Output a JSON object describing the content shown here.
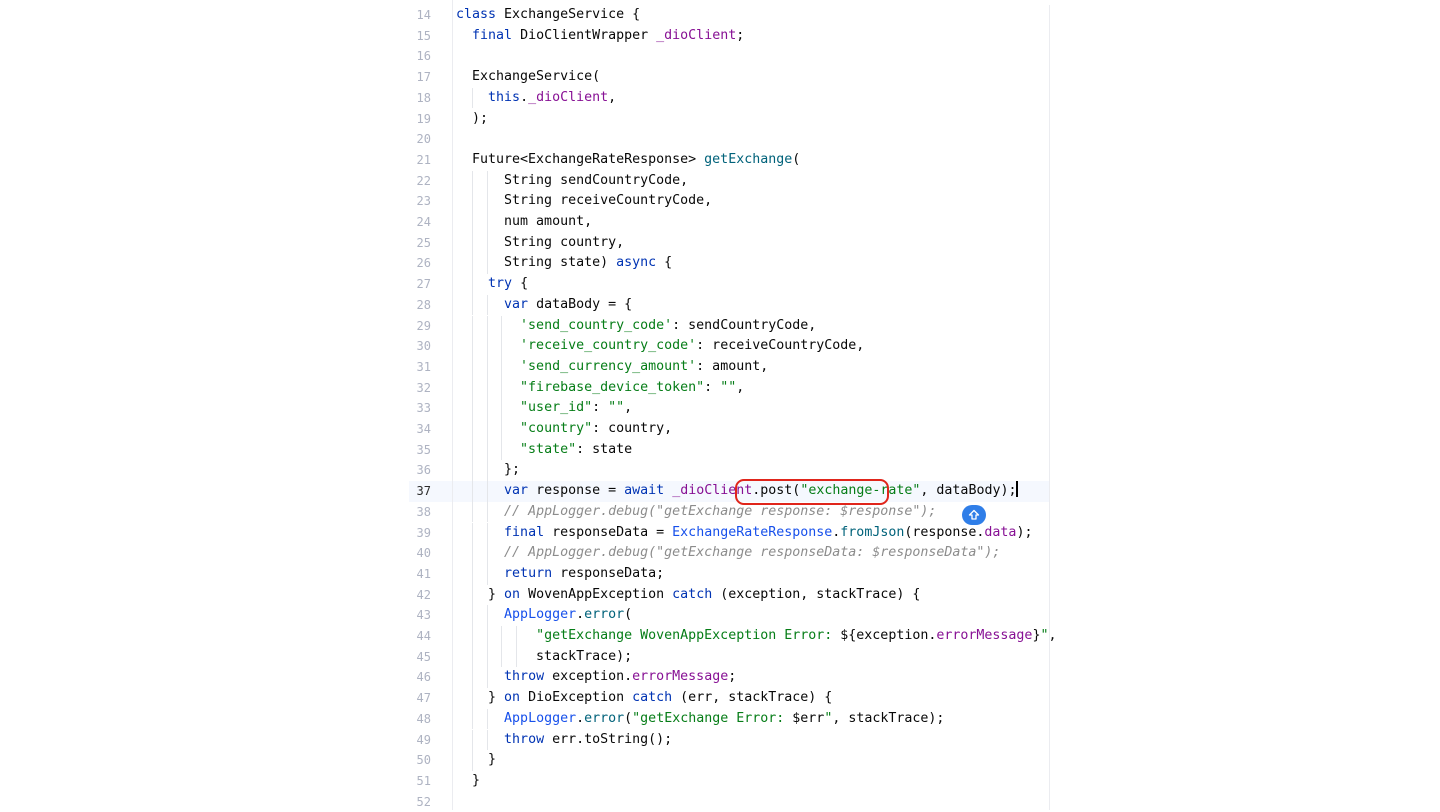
{
  "editor": {
    "current_line": 37,
    "lines": [
      {
        "n": "14",
        "tokens": [
          {
            "t": "class ",
            "c": "kw"
          },
          {
            "t": "ExchangeService {",
            "c": ""
          }
        ]
      },
      {
        "n": "15",
        "tokens": [
          {
            "t": "  "
          },
          {
            "t": "final ",
            "c": "kw"
          },
          {
            "t": "DioClientWrapper "
          },
          {
            "t": "_dioClient",
            "c": "fld"
          },
          {
            "t": ";"
          }
        ]
      },
      {
        "n": "16",
        "tokens": []
      },
      {
        "n": "17",
        "tokens": [
          {
            "t": "  ExchangeService("
          }
        ]
      },
      {
        "n": "18",
        "tokens": [
          {
            "t": "    "
          },
          {
            "t": "this",
            "c": "kw"
          },
          {
            "t": "."
          },
          {
            "t": "_dioClient",
            "c": "fld"
          },
          {
            "t": ","
          }
        ]
      },
      {
        "n": "19",
        "tokens": [
          {
            "t": "  );"
          }
        ]
      },
      {
        "n": "20",
        "tokens": []
      },
      {
        "n": "21",
        "tokens": [
          {
            "t": "  Future<ExchangeRateResponse> "
          },
          {
            "t": "getExchange",
            "c": "fn"
          },
          {
            "t": "("
          }
        ]
      },
      {
        "n": "22",
        "tokens": [
          {
            "t": "      String sendCountryCode,"
          }
        ]
      },
      {
        "n": "23",
        "tokens": [
          {
            "t": "      String receiveCountryCode,"
          }
        ]
      },
      {
        "n": "24",
        "tokens": [
          {
            "t": "      num amount,"
          }
        ]
      },
      {
        "n": "25",
        "tokens": [
          {
            "t": "      String country,"
          }
        ]
      },
      {
        "n": "26",
        "tokens": [
          {
            "t": "      String state) "
          },
          {
            "t": "async",
            "c": "kw"
          },
          {
            "t": " {"
          }
        ]
      },
      {
        "n": "27",
        "tokens": [
          {
            "t": "    "
          },
          {
            "t": "try",
            "c": "kw"
          },
          {
            "t": " {"
          }
        ]
      },
      {
        "n": "28",
        "tokens": [
          {
            "t": "      "
          },
          {
            "t": "var",
            "c": "kw"
          },
          {
            "t": " dataBody = {"
          }
        ]
      },
      {
        "n": "29",
        "tokens": [
          {
            "t": "        "
          },
          {
            "t": "'send_country_code'",
            "c": "str"
          },
          {
            "t": ": sendCountryCode,"
          }
        ]
      },
      {
        "n": "30",
        "tokens": [
          {
            "t": "        "
          },
          {
            "t": "'receive_country_code'",
            "c": "str"
          },
          {
            "t": ": receiveCountryCode,"
          }
        ]
      },
      {
        "n": "31",
        "tokens": [
          {
            "t": "        "
          },
          {
            "t": "'send_currency_amount'",
            "c": "str"
          },
          {
            "t": ": amount,"
          }
        ]
      },
      {
        "n": "32",
        "tokens": [
          {
            "t": "        "
          },
          {
            "t": "\"firebase_device_token\"",
            "c": "str"
          },
          {
            "t": ": "
          },
          {
            "t": "\"\"",
            "c": "str"
          },
          {
            "t": ","
          }
        ]
      },
      {
        "n": "33",
        "tokens": [
          {
            "t": "        "
          },
          {
            "t": "\"user_id\"",
            "c": "str"
          },
          {
            "t": ": "
          },
          {
            "t": "\"\"",
            "c": "str"
          },
          {
            "t": ","
          }
        ]
      },
      {
        "n": "34",
        "tokens": [
          {
            "t": "        "
          },
          {
            "t": "\"country\"",
            "c": "str"
          },
          {
            "t": ": country,"
          }
        ]
      },
      {
        "n": "35",
        "tokens": [
          {
            "t": "        "
          },
          {
            "t": "\"state\"",
            "c": "str"
          },
          {
            "t": ": state"
          }
        ]
      },
      {
        "n": "36",
        "tokens": [
          {
            "t": "      };"
          }
        ]
      },
      {
        "n": "37",
        "tokens": [
          {
            "t": "      "
          },
          {
            "t": "var",
            "c": "kw"
          },
          {
            "t": " response = "
          },
          {
            "t": "await",
            "c": "kw"
          },
          {
            "t": " "
          },
          {
            "t": "_dioClient",
            "c": "fld"
          },
          {
            "t": ".post("
          },
          {
            "t": "\"exchange-rate\"",
            "c": "str"
          },
          {
            "t": ", dataBody);"
          }
        ]
      },
      {
        "n": "38",
        "tokens": [
          {
            "t": "      "
          },
          {
            "t": "// AppLogger.debug(\"getExchange response: $response\");",
            "c": "cmt"
          }
        ]
      },
      {
        "n": "39",
        "tokens": [
          {
            "t": "      "
          },
          {
            "t": "final",
            "c": "kw"
          },
          {
            "t": " responseData = "
          },
          {
            "t": "ExchangeRateResponse",
            "c": "cls"
          },
          {
            "t": "."
          },
          {
            "t": "fromJson",
            "c": "fn"
          },
          {
            "t": "(response."
          },
          {
            "t": "data",
            "c": "fld"
          },
          {
            "t": ");"
          }
        ]
      },
      {
        "n": "40",
        "tokens": [
          {
            "t": "      "
          },
          {
            "t": "// AppLogger.debug(\"getExchange responseData: $responseData\");",
            "c": "cmt"
          }
        ]
      },
      {
        "n": "41",
        "tokens": [
          {
            "t": "      "
          },
          {
            "t": "return",
            "c": "kw"
          },
          {
            "t": " responseData;"
          }
        ]
      },
      {
        "n": "42",
        "tokens": [
          {
            "t": "    } "
          },
          {
            "t": "on",
            "c": "kw"
          },
          {
            "t": " WovenAppException "
          },
          {
            "t": "catch",
            "c": "kw"
          },
          {
            "t": " (exception, stackTrace) {"
          }
        ]
      },
      {
        "n": "43",
        "tokens": [
          {
            "t": "      "
          },
          {
            "t": "AppLogger",
            "c": "cls"
          },
          {
            "t": "."
          },
          {
            "t": "error",
            "c": "fn"
          },
          {
            "t": "("
          }
        ]
      },
      {
        "n": "44",
        "tokens": [
          {
            "t": "          "
          },
          {
            "t": "\"getExchange WovenAppException Error: ",
            "c": "str"
          },
          {
            "t": "${exception."
          },
          {
            "t": "errorMessage",
            "c": "fld"
          },
          {
            "t": "}"
          },
          {
            "t": "\"",
            "c": "str"
          },
          {
            "t": ","
          }
        ]
      },
      {
        "n": "45",
        "tokens": [
          {
            "t": "          stackTrace);"
          }
        ]
      },
      {
        "n": "46",
        "tokens": [
          {
            "t": "      "
          },
          {
            "t": "throw",
            "c": "kw"
          },
          {
            "t": " exception."
          },
          {
            "t": "errorMessage",
            "c": "fld"
          },
          {
            "t": ";"
          }
        ]
      },
      {
        "n": "47",
        "tokens": [
          {
            "t": "    } "
          },
          {
            "t": "on",
            "c": "kw"
          },
          {
            "t": " DioException "
          },
          {
            "t": "catch",
            "c": "kw"
          },
          {
            "t": " (err, stackTrace) {"
          }
        ]
      },
      {
        "n": "48",
        "tokens": [
          {
            "t": "      "
          },
          {
            "t": "AppLogger",
            "c": "cls"
          },
          {
            "t": "."
          },
          {
            "t": "error",
            "c": "fn"
          },
          {
            "t": "("
          },
          {
            "t": "\"getExchange Error: ",
            "c": "str"
          },
          {
            "t": "$err"
          },
          {
            "t": "\"",
            "c": "str"
          },
          {
            "t": ", stackTrace);"
          }
        ]
      },
      {
        "n": "49",
        "tokens": [
          {
            "t": "      "
          },
          {
            "t": "throw",
            "c": "kw"
          },
          {
            "t": " err.toString();"
          }
        ]
      },
      {
        "n": "50",
        "tokens": [
          {
            "t": "    }"
          }
        ]
      },
      {
        "n": "51",
        "tokens": [
          {
            "t": "  }"
          }
        ]
      },
      {
        "n": "52",
        "tokens": []
      }
    ]
  },
  "annotation": {
    "highlight_label": "post(\"exchange-rate\"",
    "hint_icon": "up-arrow-icon"
  }
}
